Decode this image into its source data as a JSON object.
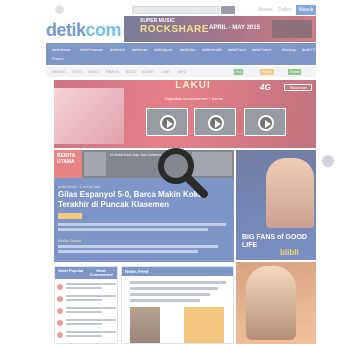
{
  "header": {
    "logo_main": "detik",
    "logo_accent": "com",
    "top_links": [
      "Masuk",
      "Daftar"
    ],
    "login_label": "Masuk"
  },
  "banner": {
    "line1": "SUPER MUSIC",
    "line2": "ROCKSHARE",
    "line3": "APRIL - MAY 2015"
  },
  "nav": {
    "items": [
      "detikNews",
      "detikFinance",
      "detikHot",
      "detikInet",
      "detikSport",
      "detikOto",
      "detikHealth",
      "detikFood",
      "detikTravel",
      "Wolipop",
      "detikTV",
      "Forum"
    ]
  },
  "subnav": {
    "items": [
      "INDEKS",
      "FOTO",
      "VIDEO",
      "GRAFIS",
      "BLOG",
      "KOMIK",
      "LIVE",
      "INFO"
    ],
    "tags": [
      "Hot",
      "Promo",
      "Event"
    ],
    "tag_colors": [
      "#4da64d",
      "#f2a536",
      "#4da64d"
    ]
  },
  "promo": {
    "title": "LAKUI",
    "subtitle": "Dapatkan kuota internet + bonus",
    "brand": "4G",
    "brand2": "Telkomsel"
  },
  "featured": {
    "badge": "BERITA UTAMA",
    "strip_text": "Ini Bukti Ahok Siap Jadi Gubernur",
    "meta": "detikSport · 1 menit lalu",
    "title": "Gilas Espanyol 5-0, Barca Makin Kokoh Terakhir di Puncak Klasemen",
    "more": "Berita Terkait"
  },
  "tabs": {
    "left": "Most Popular",
    "right": "Most Commented"
  },
  "news_panel": {
    "title": "News Feed"
  },
  "right_ad": {
    "text": "BIG FANS of GOOD LIFE",
    "brand": "blibli"
  },
  "colors": {
    "brand_blue": "#2f56a6",
    "accent_red": "#d93a3a",
    "accent_orange": "#f2a536"
  },
  "icons": {
    "overlay": "search-icon"
  }
}
